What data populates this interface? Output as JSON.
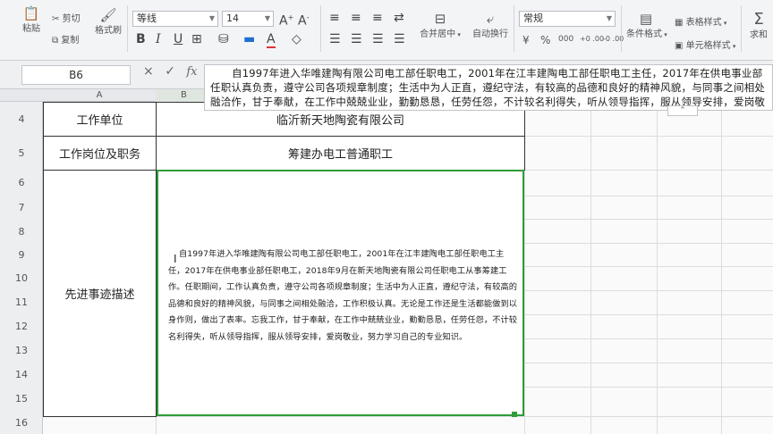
{
  "ribbon": {
    "paste": "粘贴",
    "cut": "剪切",
    "copy": "复制",
    "format_painter": "格式刷",
    "font_name": "等线",
    "font_size": "14",
    "merge_center": "合并居中",
    "wrap_text": "自动换行",
    "number_format": "常规",
    "conditional_format": "条件格式",
    "table_style": "表格样式",
    "cell_style": "单元格样式",
    "sum": "求和",
    "currency": "¥",
    "percent": "%",
    "thousands": "000",
    "dec_inc": "+0 .00",
    "dec_dec": "-0 .00"
  },
  "formula_bar": {
    "name_box": "B6",
    "cancel": "×",
    "confirm": "✓",
    "fx": "fx",
    "content": "自1997年进入华唯建陶有限公司电工部任职电工，2001年在江丰建陶电工部任职电工主任，2017年在供电事业部任职认真负责，遵守公司各项规章制度；生活中为人正直，遵纪守法，有较高的品德和良好的精神风貌，与同事之间相处融洽作，甘于奉献，在工作中兢兢业业，勤勤恳恳，任劳任怨，不计较名利得失，听从领导指挥，服从领导安排，爱岗敬业，"
  },
  "columns": [
    "A",
    "B"
  ],
  "rows": [
    "4",
    "5",
    "6",
    "7",
    "8",
    "9",
    "10",
    "11",
    "12",
    "13",
    "14",
    "15",
    "16"
  ],
  "cells": {
    "a4": "工作单位",
    "b4": "临沂新天地陶瓷有限公司",
    "a5": "工作岗位及职务",
    "b5": "筹建办电工普通职工",
    "a6": "先进事迹描述",
    "b6": "自1997年进入华唯建陶有限公司电工部任职电工，2001年在江丰建陶电工部任职电工主任，2017年在供电事业部任职电工，2018年9月在新天地陶瓷有限公司任职电工从事筹建工作。任职期间，工作认真负责，遵守公司各项规章制度；生活中为人正直，遵纪守法，有较高的品德和良好的精神风貌，与同事之间相处融洽，工作积极认真。无论是工作还是生活都能做到以身作则，做出了表率。忘我工作，甘于奉献，在工作中兢兢业业，勤勤恳恳，任劳任怨，不计较名利得失，听从领导指挥，服从领导安排，爱岗敬业，努力学习自己的专业知识。"
  },
  "colors": {
    "selection_border": "#2e9c3a",
    "ribbon_bg": "#f3f4f6",
    "sheet_bg": "#fafafa"
  }
}
